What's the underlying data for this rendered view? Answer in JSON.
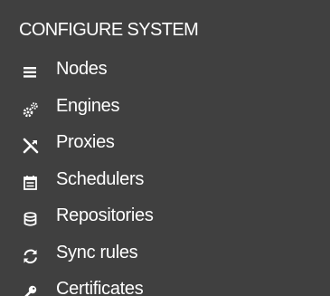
{
  "section": {
    "title": "CONFIGURE SYSTEM"
  },
  "menu": {
    "items": [
      {
        "label": "Nodes",
        "icon": "list-icon"
      },
      {
        "label": "Engines",
        "icon": "gears-icon"
      },
      {
        "label": "Proxies",
        "icon": "proxy-icon"
      },
      {
        "label": "Schedulers",
        "icon": "calendar-icon"
      },
      {
        "label": "Repositories",
        "icon": "database-icon"
      },
      {
        "label": "Sync rules",
        "icon": "sync-icon"
      },
      {
        "label": "Certificates",
        "icon": "key-icon"
      }
    ]
  },
  "colors": {
    "background": "#404040",
    "text": "#ffffff"
  }
}
